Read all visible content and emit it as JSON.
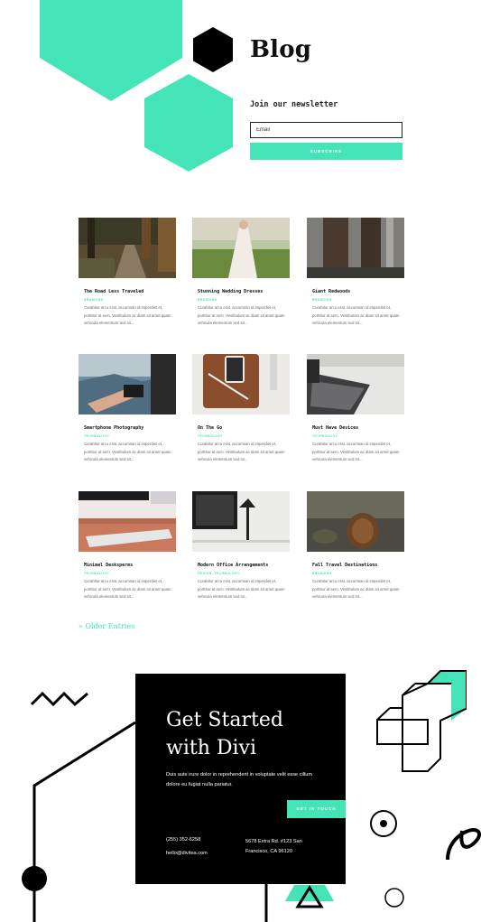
{
  "header": {
    "title": "Blog",
    "newsletter_label": "Join our newsletter",
    "email_placeholder": "Email",
    "subscribe_label": "SUBSCRIBE"
  },
  "colors": {
    "accent": "#44e3b8",
    "dark": "#000000"
  },
  "posts": [
    {
      "title": "The Road Less Traveled",
      "category": "BRANDING",
      "excerpt": "Curabitur arcu erat, accumsan id imperdiet et, porttitor at sem. Vestibulum ac diam sit amet quam vehicula elementum sed sit..."
    },
    {
      "title": "Stunning Wedding Dresses",
      "category": "BRANDING",
      "excerpt": "Curabitur arcu erat, accumsan id imperdiet et, porttitor at sem. Vestibulum ac diam sit amet quam vehicula elementum sed sit..."
    },
    {
      "title": "Giant Redwoods",
      "category": "BRANDING",
      "excerpt": "Curabitur arcu erat, accumsan id imperdiet et, porttitor at sem. Vestibulum ac diam sit amet quam vehicula elementum sed sit..."
    },
    {
      "title": "Smartphone Photography",
      "category": "TECHNOLOGY",
      "excerpt": "Curabitur arcu erat, accumsan id imperdiet et, porttitor at sem. Vestibulum ac diam sit amet quam vehicula elementum sed sit..."
    },
    {
      "title": "On The Go",
      "category": "TECHNOLOGY",
      "excerpt": "Curabitur arcu erat, accumsan id imperdiet et, porttitor at sem. Vestibulum ac diam sit amet quam vehicula elementum sed sit..."
    },
    {
      "title": "Must Have Devices",
      "category": "TECHNOLOGY",
      "excerpt": "Curabitur arcu erat, accumsan id imperdiet et, porttitor at sem. Vestibulum ac diam sit amet quam vehicula elementum sed sit..."
    },
    {
      "title": "Minimal Desksperms",
      "category": "TECHNOLOGY",
      "excerpt": "Curabitur arcu erat, accumsan id imperdiet et, porttitor at sem. Vestibulum ac diam sit amet quam vehicula elementum sed sit..."
    },
    {
      "title": "Modern Office Arrangements",
      "category": "DESIGN, TECHNOLOGY",
      "excerpt": "Curabitur arcu erat, accumsan id imperdiet et, porttitor at sem. Vestibulum ac diam sit amet quam vehicula elementum sed sit..."
    },
    {
      "title": "Fall Travel Destinations",
      "category": "BRANDING",
      "excerpt": "Curabitur arcu erat, accumsan id imperdiet et, porttitor at sem. Vestibulum ac diam sit amet quam vehicula elementum sed sit..."
    }
  ],
  "older_entries_label": "« Older Entries",
  "cta": {
    "title": "Get Started with Divi",
    "body": "Duis aute irure dolor in reprehenderit in voluptate velit esse cillum dolore eu fugiat nulla pariatur.",
    "button_label": "GET IN TOUCH",
    "phone": "(255) 352-6258",
    "email": "hello@divitea.com",
    "address": "5678 Extra Rd. #123 San Francisco, CA 96120"
  }
}
